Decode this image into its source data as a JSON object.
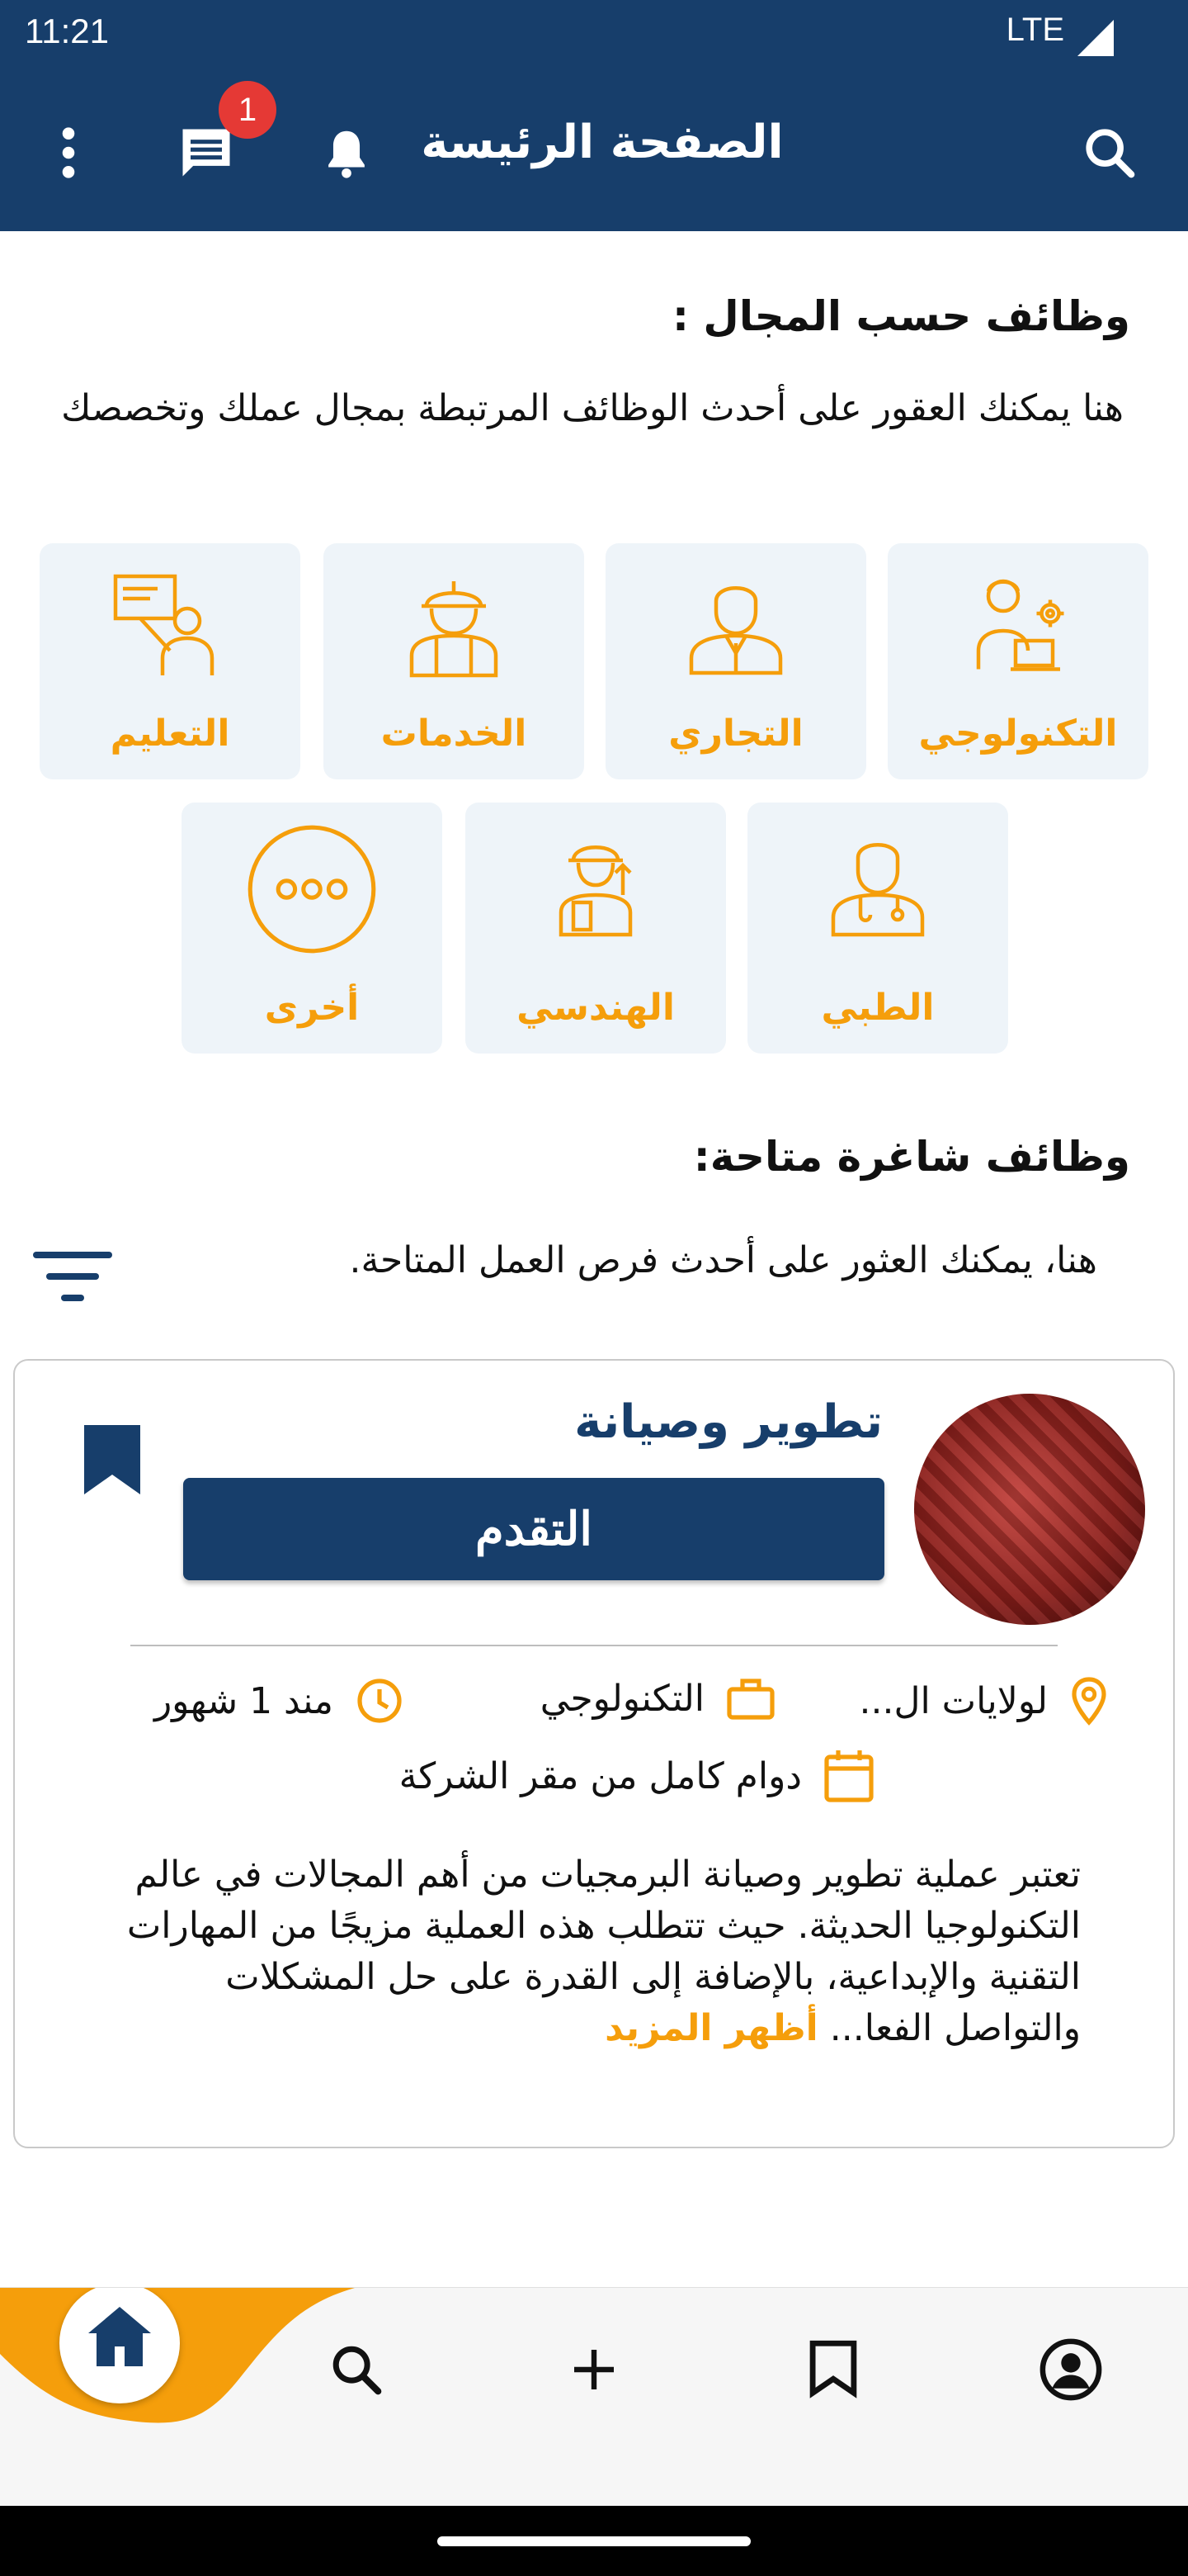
{
  "status": {
    "time": "11:21",
    "network": "LTE"
  },
  "appbar": {
    "title": "الصفحة الرئيسة",
    "chat_badge": "1"
  },
  "fields": {
    "title": "وظائف حسب المجال :",
    "subtitle": "هنا يمكنك العقور على أحدث الوظائف المرتبطة بمجال عملك وتخصصك",
    "categories": [
      {
        "label": "التكنولوجي",
        "icon": "tech-worker-icon"
      },
      {
        "label": "التجاري",
        "icon": "businessman-icon"
      },
      {
        "label": "الخدمات",
        "icon": "construction-worker-icon"
      },
      {
        "label": "التعليم",
        "icon": "teacher-icon"
      },
      {
        "label": "الطبي",
        "icon": "doctor-icon"
      },
      {
        "label": "الهندسي",
        "icon": "engineer-icon"
      },
      {
        "label": "أخرى",
        "icon": "more-dots-icon"
      }
    ]
  },
  "jobs": {
    "title": "وظائف شاغرة متاحة:",
    "subtitle": "هنا، يمكنك العثور على أحدث فرص العمل المتاحة."
  },
  "job_card": {
    "title": "تطوير وصيانة",
    "apply_label": "التقدم",
    "location": "لولايات ال...",
    "category": "التكنولوجي",
    "posted": "مند 1 شهور",
    "type": "دوام كامل من مقر الشركة",
    "description": "تعتبر عملية تطوير وصيانة البرمجيات من أهم المجالات في عالم التكنولوجيا الحديثة. حيث تتطلب هذه العملية مزيجًا من المهارات التقنية والإبداعية، بالإضافة إلى القدرة على حل المشكلات والتواصل الفعا...",
    "more_label": "أظهر المزيد"
  },
  "colors": {
    "primary": "#173e6b",
    "accent": "#f59e0b",
    "tile_bg": "#eef4f9"
  },
  "nav": [
    "home-icon",
    "search-icon",
    "add-icon",
    "bookmark-icon",
    "profile-icon"
  ]
}
